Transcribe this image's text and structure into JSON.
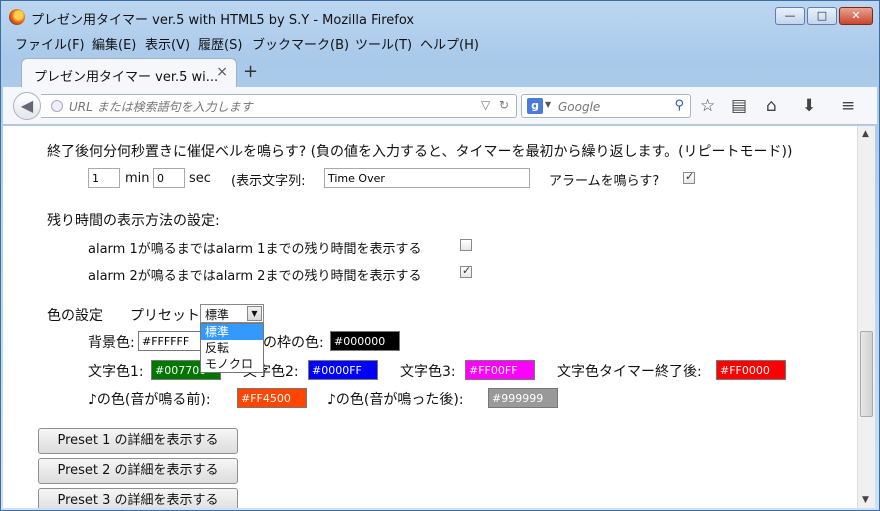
{
  "window": {
    "title": "プレゼン用タイマー ver.5 with HTML5 by S.Y - Mozilla Firefox",
    "min_label": "—",
    "max_label": "□",
    "close_label": "✕"
  },
  "menu": [
    "ファイル(F)",
    "編集(E)",
    "表示(V)",
    "履歴(S)",
    "ブックマーク(B)",
    "ツール(T)",
    "ヘルプ(H)"
  ],
  "tab": {
    "label": "プレゼン用タイマー ver.5 wi...",
    "close": "×",
    "new": "+"
  },
  "nav": {
    "url_placeholder": "URL または検索語句を入力します",
    "search_engine": "g",
    "search_placeholder": "Google"
  },
  "repeat": {
    "heading": "終了後何分何秒置きに催促ベルを鳴らす? (負の値を入力すると、タイマーを最初から繰り返します。(リピートモード))",
    "min_value": "1",
    "min_unit": "min",
    "sec_value": "0",
    "sec_unit": "sec",
    "text_label": "(表示文字列:",
    "text_value": "Time Over",
    "alarm_label": "アラームを鳴らす?",
    "alarm_checked": true
  },
  "display": {
    "heading": "残り時間の表示方法の設定:",
    "option1": "alarm 1が鳴るまではalarm 1までの残り時間を表示する",
    "option1_checked": false,
    "option2": "alarm 2が鳴るまではalarm 2までの残り時間を表示する",
    "option2_checked": true
  },
  "colors": {
    "heading": "色の設定",
    "preset_label": "プリセット",
    "preset_selected": "標準",
    "preset_options": [
      "標準",
      "反転",
      "モノクロ"
    ],
    "bg_label": "背景色:",
    "bg_value": "#FFFFFF",
    "border_label": "の枠の色:",
    "border_value": "#000000",
    "text1_label": "文字色1:",
    "text1_value": "#007700",
    "text2_label": "文字色2:",
    "text2_value": "#0000FF",
    "text3_label": "文字色3:",
    "text3_value": "#FF00FF",
    "textend_label": "文字色タイマー終了後:",
    "textend_value": "#FF0000",
    "note1_label": "♪の色(音が鳴る前):",
    "note1_value": "#FF4500",
    "note2_label": "♪の色(音が鳴った後):",
    "note2_value": "#999999"
  },
  "presets": [
    "Preset 1 の詳細を表示する",
    "Preset 2 の詳細を表示する",
    "Preset 3 の詳細を表示する"
  ]
}
